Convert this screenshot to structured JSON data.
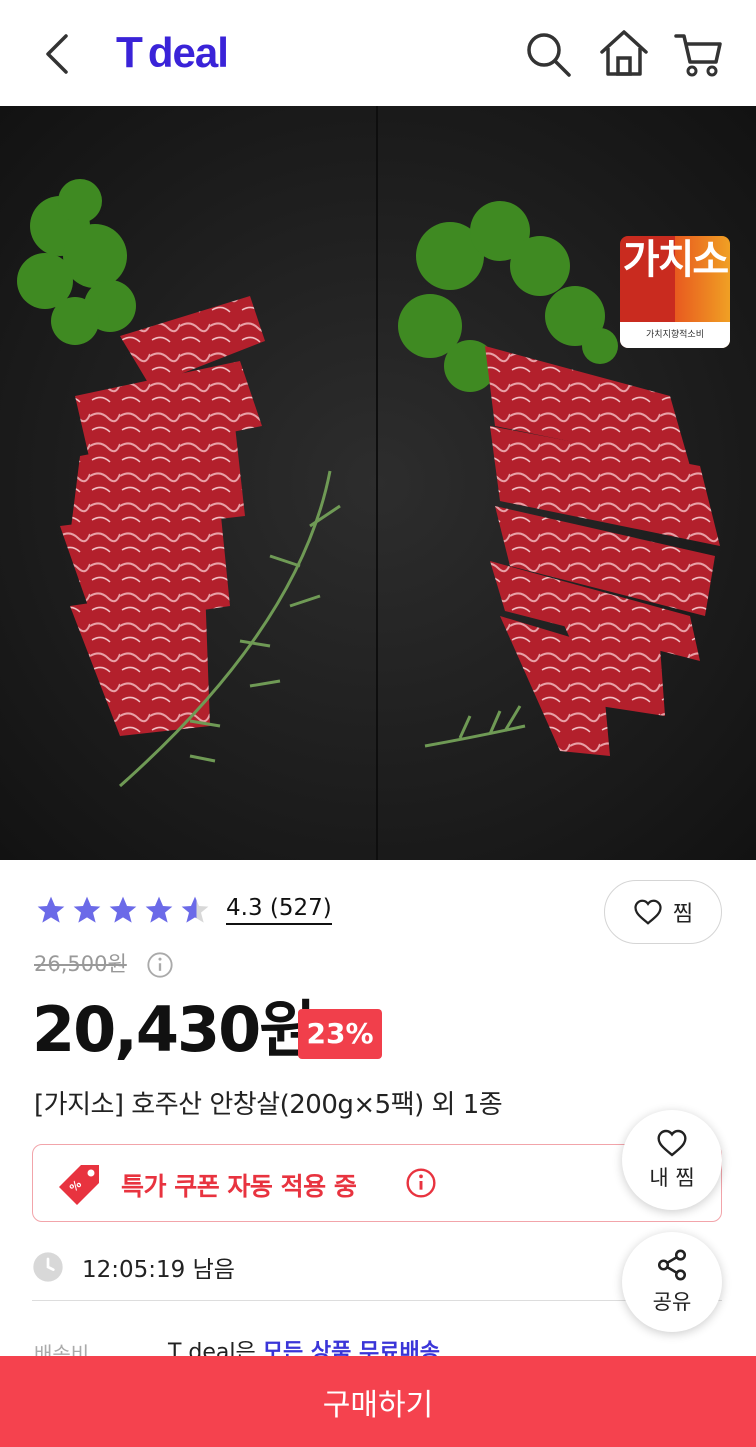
{
  "header": {
    "logo_prefix": "T",
    "logo_text": "deal",
    "logo_color": "#3a23d8"
  },
  "product": {
    "image": {
      "badge_main": "가치소",
      "badge_sub": "가치지향적소비"
    },
    "rating": {
      "score": "4.3",
      "count": "(527)",
      "stars_value": 4.3
    },
    "wish_label": "찜",
    "original_price": "26,500원",
    "price": "20,430원",
    "discount": "23%",
    "title": "[가지소] 호주산 안창살(200g×5팩) 외 1종",
    "coupon_text": "특가 쿠폰 자동 적용 중",
    "timer": "12:05:19 남음",
    "shipping_label": "배송비",
    "shipping_text_prefix": "T deal은 ",
    "shipping_link": "모든 상품 무료배송"
  },
  "floating": {
    "my_wish": "내 찜",
    "share": "공유"
  },
  "buy_button": "구매하기",
  "colors": {
    "accent_red": "#f5424e",
    "star": "#6b6ae8",
    "link_blue": "#3a35d8"
  }
}
